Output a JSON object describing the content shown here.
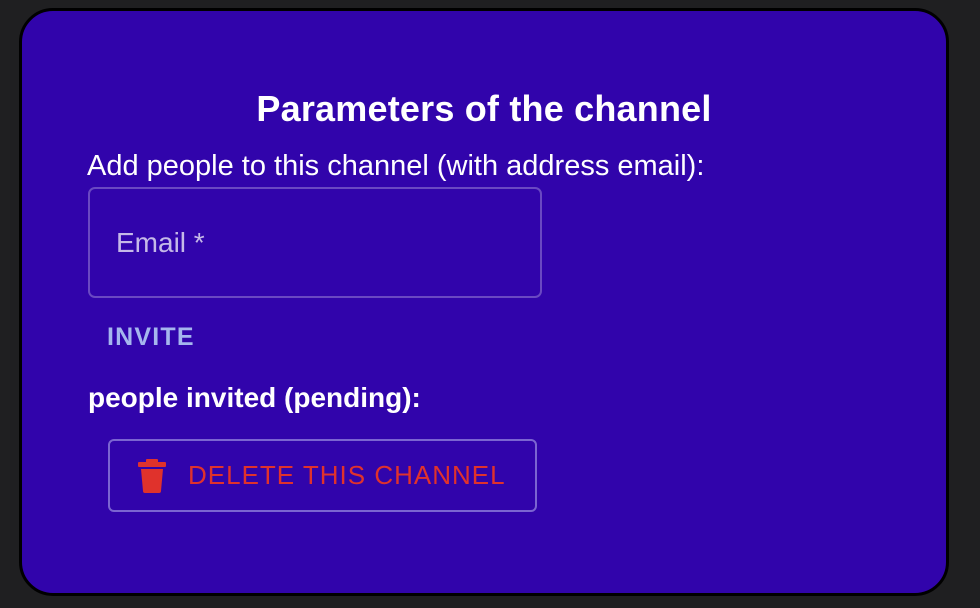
{
  "dialog": {
    "title": "Parameters of the channel",
    "subtitle": "Add people to this channel (with address email):",
    "email_field": {
      "placeholder": "Email *",
      "value": ""
    },
    "invite_label": "INVITE",
    "pending_label": "people invited (pending):",
    "delete_button": {
      "label": "DELETE THIS CHANNEL",
      "icon": "trash-icon"
    }
  },
  "colors": {
    "background": "#1f1f21",
    "dialog_background": "#3104ab",
    "invite_text": "#a5b6ee",
    "delete_text": "#e0322c"
  }
}
